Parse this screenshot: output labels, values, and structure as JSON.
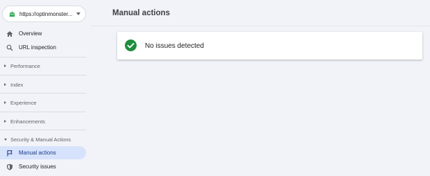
{
  "property": {
    "url": "https://optinmonster..."
  },
  "nav": {
    "overview": "Overview",
    "url_inspection": "URL inspection",
    "manual_actions": "Manual actions",
    "security_issues": "Security issues"
  },
  "sections": {
    "performance": "Performance",
    "index": "Index",
    "experience": "Experience",
    "enhancements": "Enhancements",
    "security_manual_actions": "Security & Manual Actions"
  },
  "main": {
    "title": "Manual actions",
    "status_message": "No issues detected"
  },
  "colors": {
    "success": "#1e8e3e",
    "active_bg": "#d7e3fc",
    "page_bg": "#f1f3f8"
  }
}
